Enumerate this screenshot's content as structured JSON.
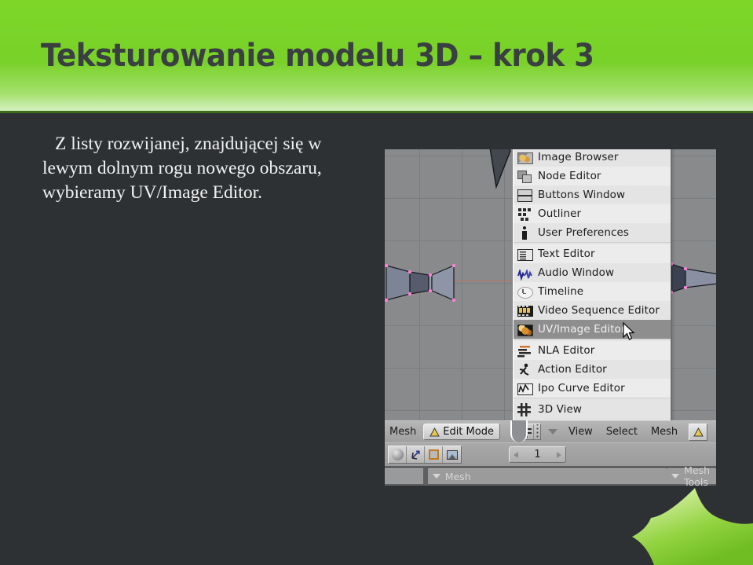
{
  "slide": {
    "title": "Teksturowanie modelu 3D – krok 3",
    "body": "Z listy rozwijanej, znajdującej się w lewym dolnym rogu nowego obszaru, wybieramy UV/Image Editor.",
    "colors": {
      "header_green_top": "#7ed629",
      "header_green_bottom": "#d5f0bd",
      "header_rule": "#3f6b1d",
      "body_background": "#2e3134",
      "title_text": "#3a3f42",
      "body_text": "#f2f2f2",
      "star_accent": "#8ccf3f"
    }
  },
  "screenshot": {
    "app": "Blender",
    "viewport": {
      "background_color": "#888a8c",
      "axis_line_color": "#b8785f",
      "vertex_color": "#ff7fd4",
      "mesh_fill": "#8d93a4"
    },
    "editor_type_menu": {
      "selected": "UV/Image Editor",
      "items": [
        {
          "label": "Image Browser",
          "icon": "image-browser-icon",
          "group": 1
        },
        {
          "label": "Node Editor",
          "icon": "node-editor-icon",
          "group": 1
        },
        {
          "label": "Buttons Window",
          "icon": "buttons-window-icon",
          "group": 1
        },
        {
          "label": "Outliner",
          "icon": "outliner-icon",
          "group": 1
        },
        {
          "label": "User Preferences",
          "icon": "user-preferences-icon",
          "group": 1
        },
        {
          "label": "Text Editor",
          "icon": "text-editor-icon",
          "group": 2
        },
        {
          "label": "Audio Window",
          "icon": "audio-window-icon",
          "group": 2
        },
        {
          "label": "Timeline",
          "icon": "timeline-icon",
          "group": 2
        },
        {
          "label": "Video Sequence Editor",
          "icon": "video-sequence-editor-icon",
          "group": 2
        },
        {
          "label": "UV/Image Editor",
          "icon": "uv-image-editor-icon",
          "group": 2
        },
        {
          "label": "NLA Editor",
          "icon": "nla-editor-icon",
          "group": 3
        },
        {
          "label": "Action Editor",
          "icon": "action-editor-icon",
          "group": 3
        },
        {
          "label": "Ipo Curve Editor",
          "icon": "ipo-curve-editor-icon",
          "group": 3
        },
        {
          "label": "3D View",
          "icon": "3d-view-icon",
          "group": 4
        }
      ]
    },
    "header_row": {
      "mesh_menu_label": "Mesh",
      "mode_button_label": "Edit Mode",
      "view_label": "View",
      "select_label": "Select",
      "mesh_label": "Mesh"
    },
    "tool_row": {
      "frame_value": "1",
      "buttons": [
        "shading-sphere-icon",
        "transform-axis-icon",
        "bounding-box-icon",
        "texture-image-icon"
      ]
    },
    "panel_row": {
      "tabs": [
        "Mesh",
        "Mesh Tools"
      ]
    }
  }
}
